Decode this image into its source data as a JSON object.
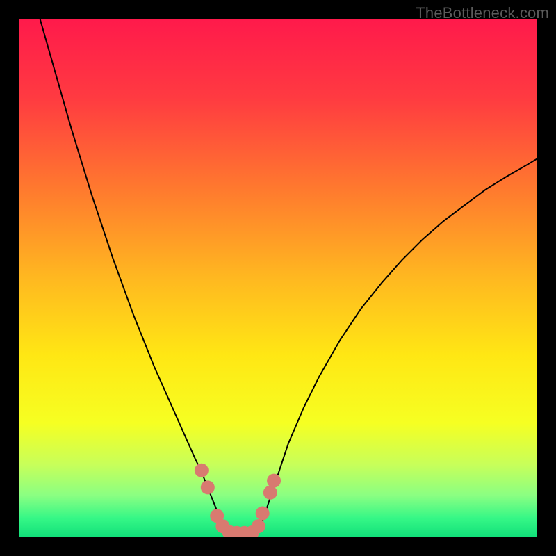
{
  "watermark": "TheBottleneck.com",
  "chart_data": {
    "type": "line",
    "title": "",
    "xlabel": "",
    "ylabel": "",
    "xlim": [
      0,
      100
    ],
    "ylim": [
      0,
      100
    ],
    "grid": false,
    "legend": false,
    "background_gradient_stops": [
      {
        "offset": 0.0,
        "color": "#ff1a4b"
      },
      {
        "offset": 0.15,
        "color": "#ff3a41"
      },
      {
        "offset": 0.33,
        "color": "#ff7a2e"
      },
      {
        "offset": 0.5,
        "color": "#ffb820"
      },
      {
        "offset": 0.65,
        "color": "#ffe714"
      },
      {
        "offset": 0.78,
        "color": "#f6ff22"
      },
      {
        "offset": 0.86,
        "color": "#c8ff59"
      },
      {
        "offset": 0.92,
        "color": "#8bff82"
      },
      {
        "offset": 0.965,
        "color": "#35f786"
      },
      {
        "offset": 1.0,
        "color": "#12e07a"
      }
    ],
    "series": [
      {
        "name": "left-curve",
        "type": "line",
        "x": [
          4,
          6,
          8,
          10,
          12,
          14,
          16,
          18,
          20,
          22,
          24,
          26,
          28,
          30,
          32,
          34,
          35,
          36,
          37,
          38,
          39,
          40
        ],
        "y": [
          100,
          93,
          86,
          79,
          72.5,
          66,
          60,
          54,
          48.5,
          43,
          38,
          33,
          28.5,
          24,
          19.5,
          15,
          13,
          10.5,
          8,
          5.5,
          3,
          0.8
        ],
        "stroke": "#000000",
        "stroke_width": 2
      },
      {
        "name": "right-curve",
        "type": "line",
        "x": [
          46,
          47,
          48,
          50,
          52,
          55,
          58,
          62,
          66,
          70,
          74,
          78,
          82,
          86,
          90,
          94,
          98,
          100
        ],
        "y": [
          0.8,
          3,
          6,
          12,
          18,
          25,
          31,
          38,
          44,
          49,
          53.5,
          57.5,
          61,
          64,
          67,
          69.5,
          71.8,
          73
        ],
        "stroke": "#000000",
        "stroke_width": 2
      },
      {
        "name": "trough-floor",
        "type": "line",
        "x": [
          40,
          41,
          42,
          43,
          44,
          45,
          46
        ],
        "y": [
          0.8,
          0.6,
          0.55,
          0.55,
          0.55,
          0.6,
          0.8
        ],
        "stroke": "#000000",
        "stroke_width": 2
      },
      {
        "name": "trough-markers",
        "type": "scatter",
        "points": [
          {
            "x": 35.2,
            "y": 12.8
          },
          {
            "x": 36.4,
            "y": 9.5
          },
          {
            "x": 38.2,
            "y": 4.0
          },
          {
            "x": 39.3,
            "y": 2.0
          },
          {
            "x": 40.5,
            "y": 0.9
          },
          {
            "x": 42.0,
            "y": 0.7
          },
          {
            "x": 43.5,
            "y": 0.7
          },
          {
            "x": 45.0,
            "y": 0.8
          },
          {
            "x": 46.2,
            "y": 2.0
          },
          {
            "x": 47.0,
            "y": 4.5
          },
          {
            "x": 48.5,
            "y": 8.5
          },
          {
            "x": 49.2,
            "y": 10.8
          }
        ],
        "marker_color": "#d87a70",
        "marker_radius": 10
      }
    ]
  }
}
